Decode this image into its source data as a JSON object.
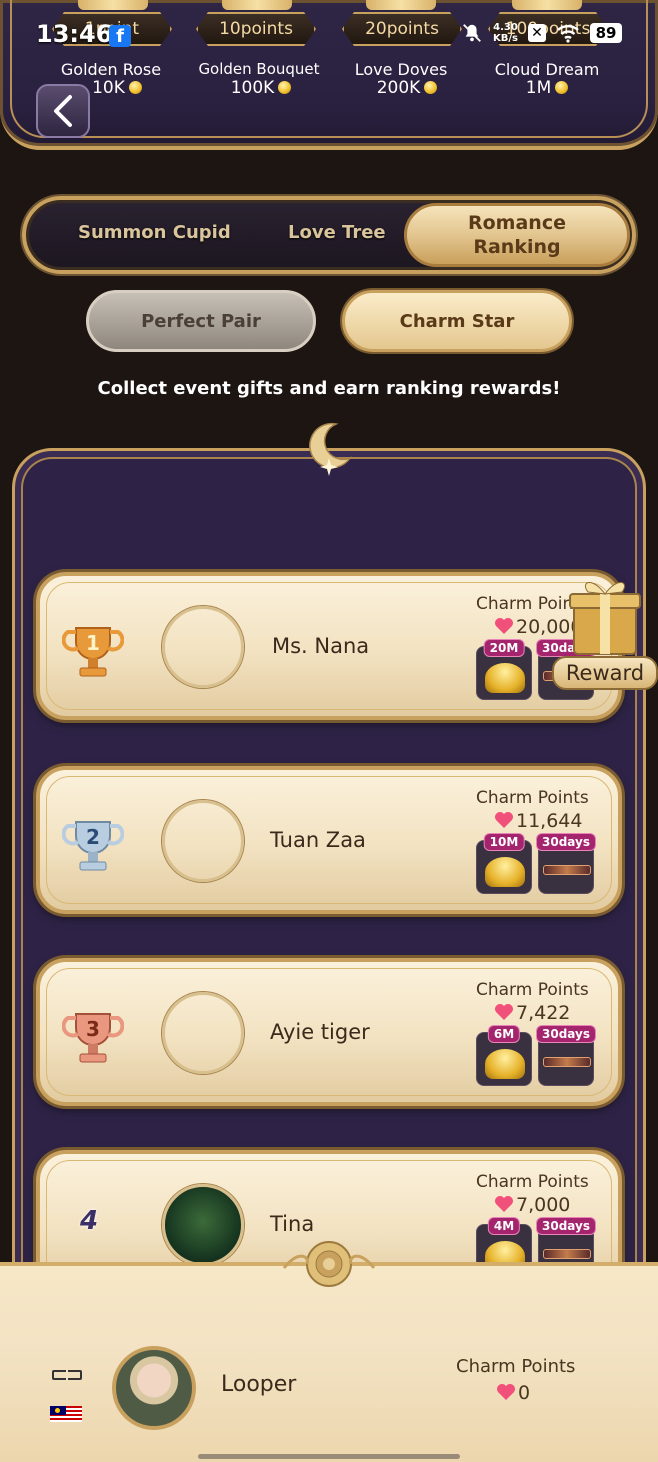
{
  "status_bar": {
    "time": "13:46",
    "net_speed_value": "4.30",
    "net_speed_unit": "KB/s",
    "battery": "89"
  },
  "gifts": [
    {
      "points": "1point",
      "name": "Golden Rose",
      "price": "10K"
    },
    {
      "points": "10points",
      "name": "Golden Bouquet",
      "price": "100K"
    },
    {
      "points": "20points",
      "name": "Love Doves",
      "price": "200K"
    },
    {
      "points": "100points",
      "name": "Cloud Dream",
      "price": "1M"
    }
  ],
  "main_tabs": [
    "Summon Cupid",
    "Love Tree",
    "Romance Ranking"
  ],
  "main_tab_active_lines": [
    "Romance",
    "Ranking"
  ],
  "sub_tabs": {
    "inactive": "Perfect Pair",
    "active": "Charm Star"
  },
  "info_text": "Collect event gifts and earn ranking rewards!",
  "reward_badge_label": "Reward",
  "ranking": [
    {
      "rank": "1",
      "name": "Ms. Nana",
      "charm_label": "Charm Points",
      "charm": "20,000",
      "reward_coin_tag": "20M",
      "reward_days_tag": "30days"
    },
    {
      "rank": "2",
      "name": "Tuan Zaa",
      "charm_label": "Charm Points",
      "charm": "11,644",
      "reward_coin_tag": "10M",
      "reward_days_tag": "30days"
    },
    {
      "rank": "3",
      "name": "Ayie tiger",
      "charm_label": "Charm Points",
      "charm": "7,422",
      "reward_coin_tag": "6M",
      "reward_days_tag": "30days"
    },
    {
      "rank": "4",
      "name": "Tina",
      "charm_label": "Charm Points",
      "charm": "7,000",
      "reward_coin_tag": "4M",
      "reward_days_tag": "30days"
    }
  ],
  "self": {
    "name": "Looper",
    "charm_label": "Charm Points",
    "charm": "0"
  },
  "colors": {
    "gold": "#c9a15e",
    "panel": "#2e2346",
    "card": "#f2e2c1",
    "tag": "#a4246e",
    "heart": "#f0507a"
  },
  "icons": [
    "back-arrow-icon",
    "facebook-icon",
    "mute-icon",
    "close-icon",
    "wifi-icon",
    "battery-icon",
    "trophy-gold-icon",
    "trophy-silver-icon",
    "trophy-bronze-icon",
    "heart-icon",
    "coin-icon",
    "gift-box-icon",
    "malaysia-flag-icon"
  ]
}
